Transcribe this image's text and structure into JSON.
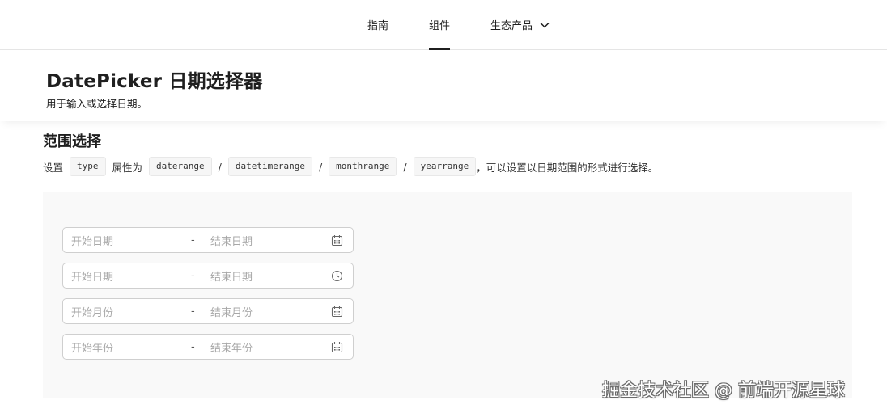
{
  "nav": {
    "items": [
      {
        "label": "指南"
      },
      {
        "label": "组件"
      },
      {
        "label": "生态产品"
      }
    ]
  },
  "header": {
    "title": "DatePicker 日期选择器",
    "description": "用于输入或选择日期。"
  },
  "section": {
    "title": "范围选择",
    "desc_prefix": "设置",
    "code_type": "type",
    "desc_mid": "属性为",
    "code_daterange": "daterange",
    "code_datetimerange": "datetimerange",
    "code_monthrange": "monthrange",
    "code_yearrange": "yearrange",
    "slash": "/",
    "desc_suffix": "，可以设置以日期范围的形式进行选择。"
  },
  "pickers": [
    {
      "start_placeholder": "开始日期",
      "separator": "-",
      "end_placeholder": "结束日期",
      "icon": "calendar-icon"
    },
    {
      "start_placeholder": "开始日期",
      "separator": "-",
      "end_placeholder": "结束日期",
      "icon": "clock-icon"
    },
    {
      "start_placeholder": "开始月份",
      "separator": "-",
      "end_placeholder": "结束月份",
      "icon": "calendar-icon"
    },
    {
      "start_placeholder": "开始年份",
      "separator": "-",
      "end_placeholder": "结束年份",
      "icon": "calendar-icon"
    }
  ],
  "watermark": "掘金技术社区 @ 前端开源星球"
}
